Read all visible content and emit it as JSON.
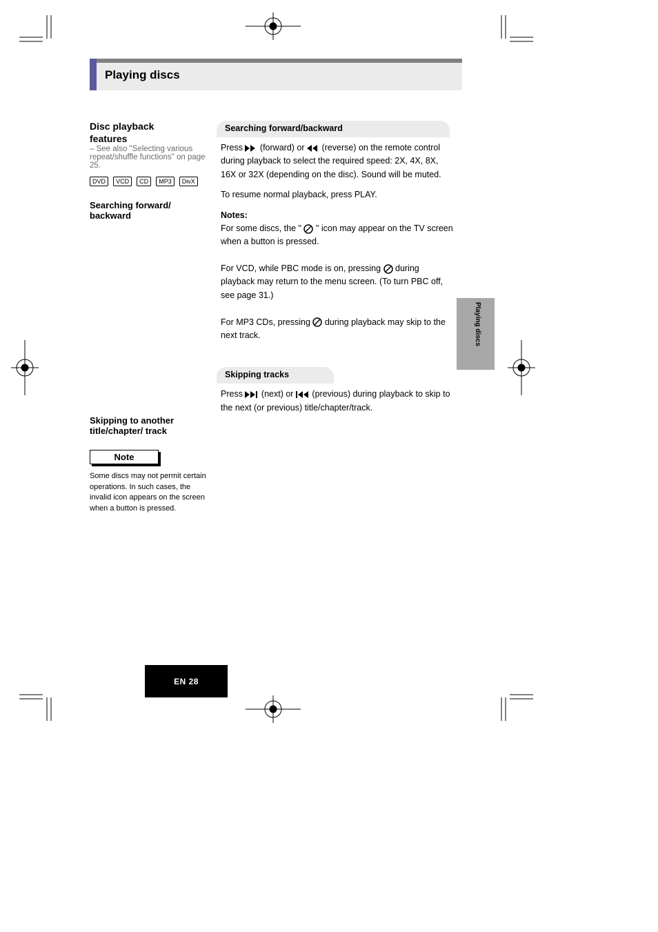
{
  "title": "Playing discs",
  "side_tab": "Playing discs",
  "section1": {
    "heading_line1": "Disc playback",
    "heading_line2": "features",
    "sub": "– See also \"Selecting various repeat/shuffle functions\" on page 25.",
    "discs": [
      "DVD",
      "VCD",
      "CD",
      "MP3",
      "DivX"
    ],
    "h_search": "Searching forward/ backward",
    "h_skip": "Skipping to another title/chapter/ track"
  },
  "pill1": "Searching forward/backward",
  "search": {
    "p1_a": "Press ",
    "p1_b": " (forward) or ",
    "p1_c": " (reverse) on the remote control during playback to select the required speed: 2X, 4X, 8X, 16X or 32X (depending on the disc). Sound will be muted.",
    "p2": "To resume normal playback, press PLAY.",
    "notes_label": "Notes:",
    "n1_a": "For some discs, the \"",
    "n1_b": "\" icon may appear on the TV screen when a button is pressed.",
    "n2_a": "For VCD, while PBC mode is on, pressing ",
    "n2_b": " during playback may return to the menu screen. (To turn PBC off, see page 31.)",
    "n3_a": "For MP3 CDs, pressing ",
    "n3_b": " during playback may skip to the next track."
  },
  "pill2": "Skipping tracks",
  "skip": {
    "p1_a": "Press ",
    "p1_b": " (next) or ",
    "p1_c": " (previous) during playback to skip to the next (or previous) title/chapter/track."
  },
  "note_box": "Note",
  "note_body": "Some discs may not permit certain operations. In such cases, the invalid icon appears on the screen when a button is pressed.",
  "page_label": "EN  28"
}
